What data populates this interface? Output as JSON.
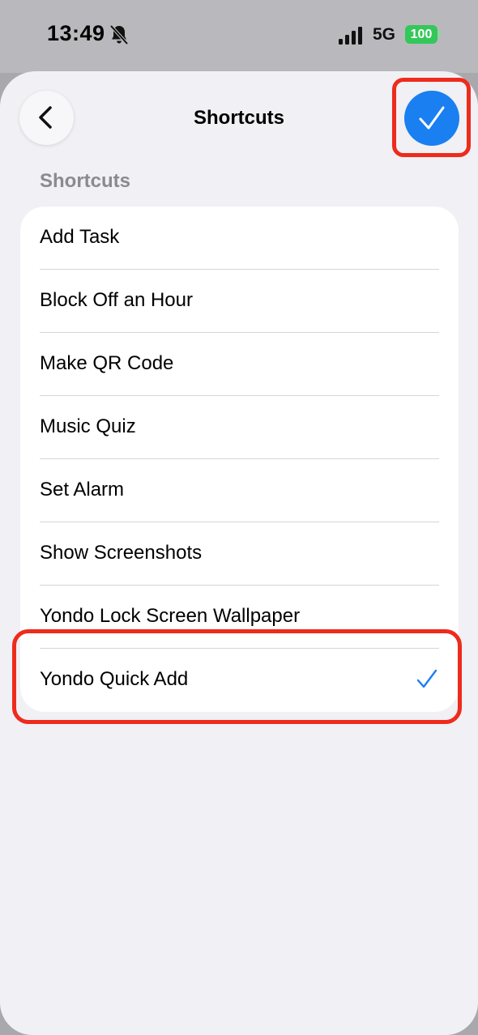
{
  "status_bar": {
    "time": "13:49",
    "network": "5G",
    "battery": "100",
    "icons": [
      "bell-slash-icon",
      "signal-icon",
      "battery-icon"
    ],
    "battery_color": "#34c759"
  },
  "nav": {
    "title": "Shortcuts",
    "back_icon": "chevron-left-icon",
    "done_icon": "checkmark-icon",
    "accent": "#1a7ff0"
  },
  "section": {
    "header": "Shortcuts"
  },
  "shortcuts": [
    {
      "label": "Add Task",
      "selected": false
    },
    {
      "label": "Block Off an Hour",
      "selected": false
    },
    {
      "label": "Make QR Code",
      "selected": false
    },
    {
      "label": "Music Quiz",
      "selected": false
    },
    {
      "label": "Set Alarm",
      "selected": false
    },
    {
      "label": "Show Screenshots",
      "selected": false
    },
    {
      "label": "Yondo Lock Screen Wallpaper",
      "selected": false
    },
    {
      "label": "Yondo Quick Add",
      "selected": true
    }
  ],
  "highlight_color": "#ee2b1c"
}
